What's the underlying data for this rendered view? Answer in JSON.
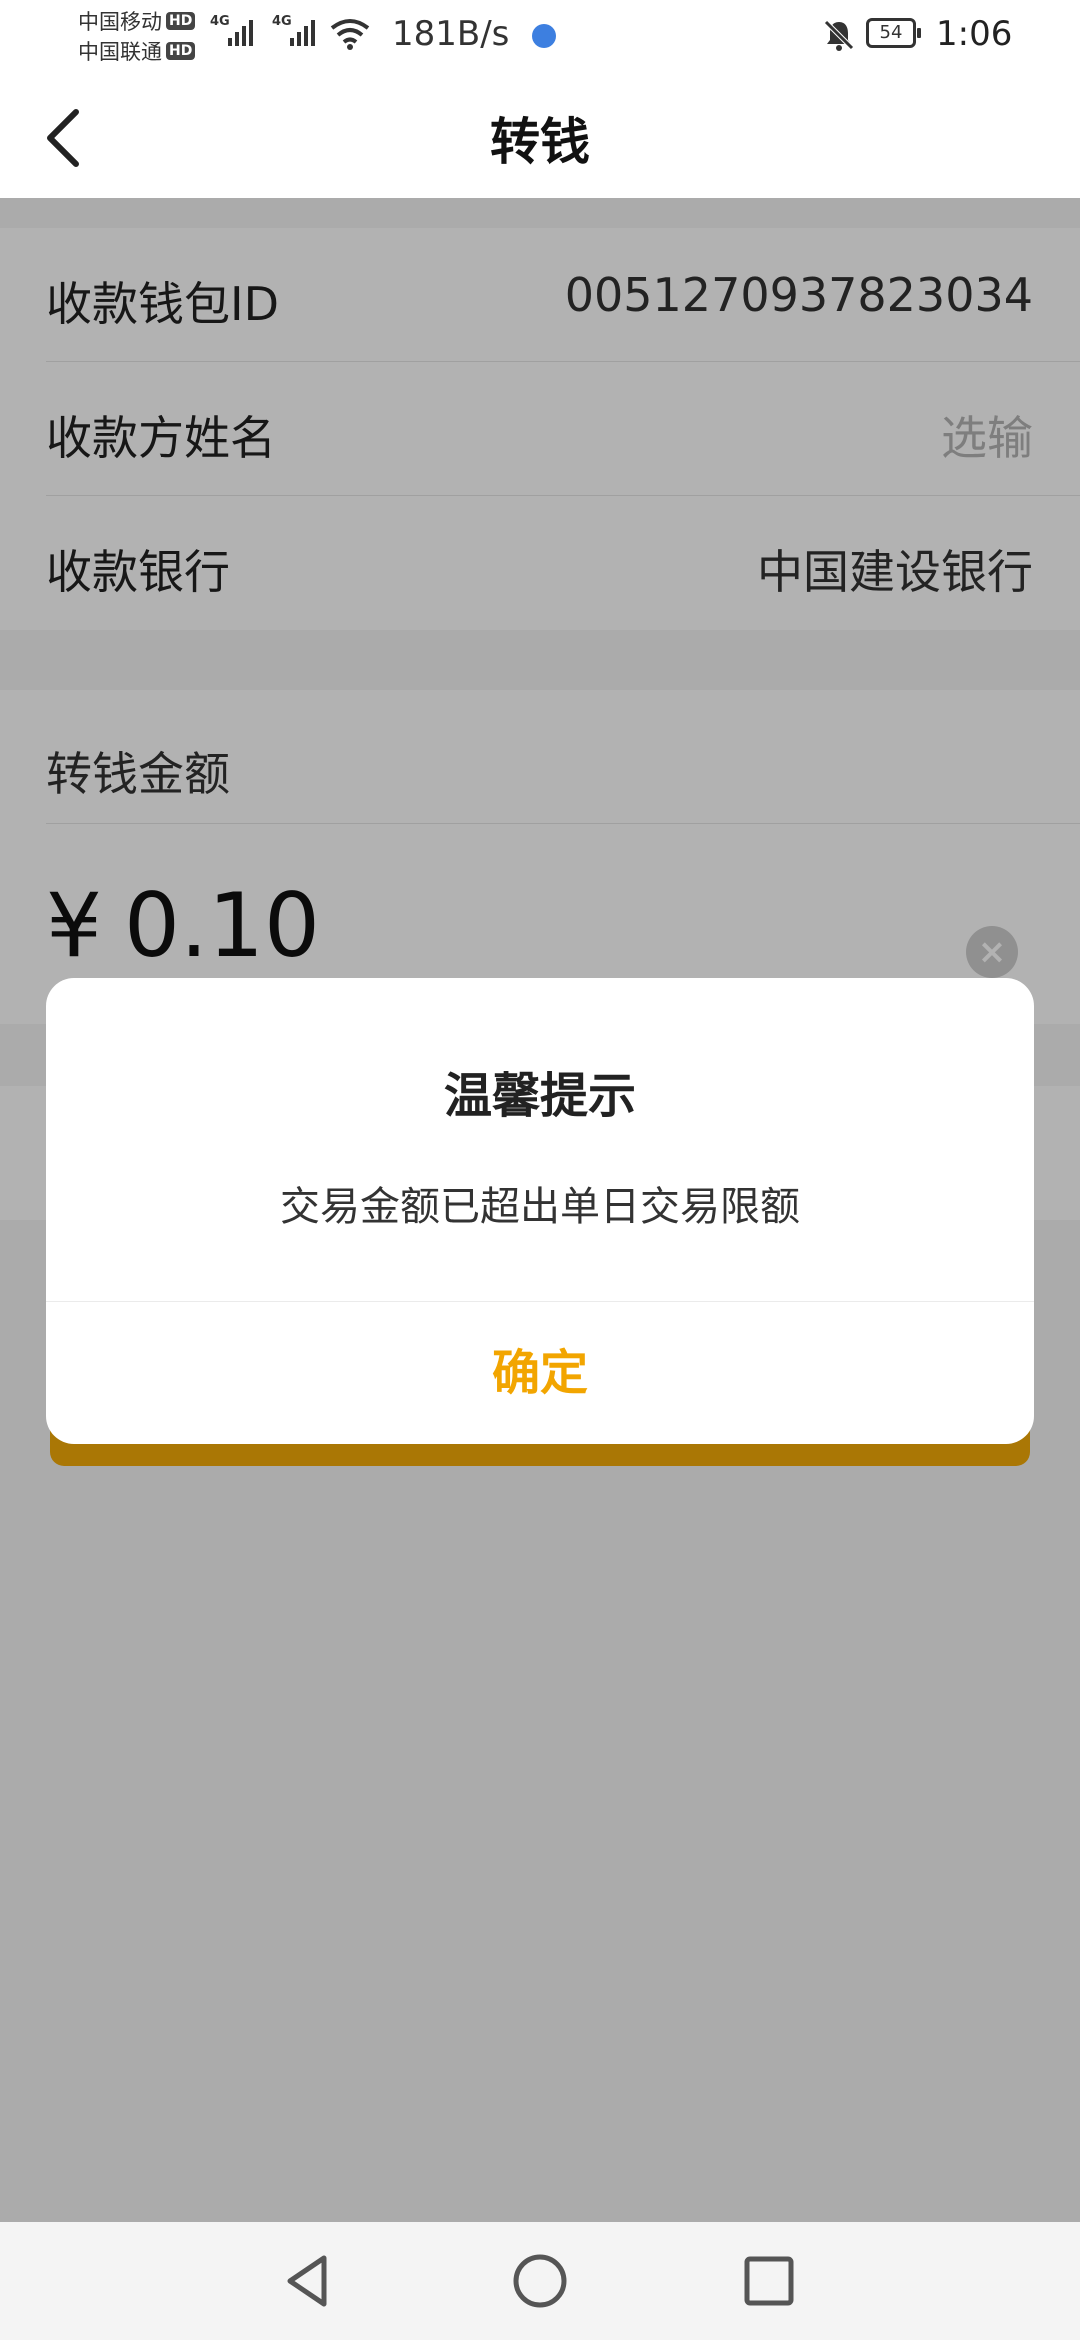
{
  "status_bar": {
    "carrier_1": "中国移动",
    "carrier_2": "中国联通",
    "hd_badge": "HD",
    "network_tag": "4G",
    "net_speed": "181B/s",
    "battery": "54",
    "time": "1:06"
  },
  "header": {
    "title": "转钱",
    "back_icon": "chevron-left-icon"
  },
  "form": {
    "wallet_id_label": "收款钱包ID",
    "wallet_id_value": "0051270937823034",
    "payee_name_label": "收款方姓名",
    "payee_name_placeholder": "选输",
    "bank_label": "收款银行",
    "bank_value": "中国建设银行",
    "amount_label": "转钱金额",
    "currency_symbol": "¥",
    "amount_value": "0.10",
    "clear_icon": "clear-icon"
  },
  "dialog": {
    "title": "温馨提示",
    "message": "交易金额已超出单日交易限额",
    "confirm_label": "确定"
  },
  "colors": {
    "accent": "#f2a500",
    "button_bg": "#f4ab08",
    "mask": "rgba(0,0,0,0.3)"
  },
  "nav_bar": {
    "back": "triangle-back-icon",
    "home": "circle-home-icon",
    "recents": "square-recents-icon"
  }
}
